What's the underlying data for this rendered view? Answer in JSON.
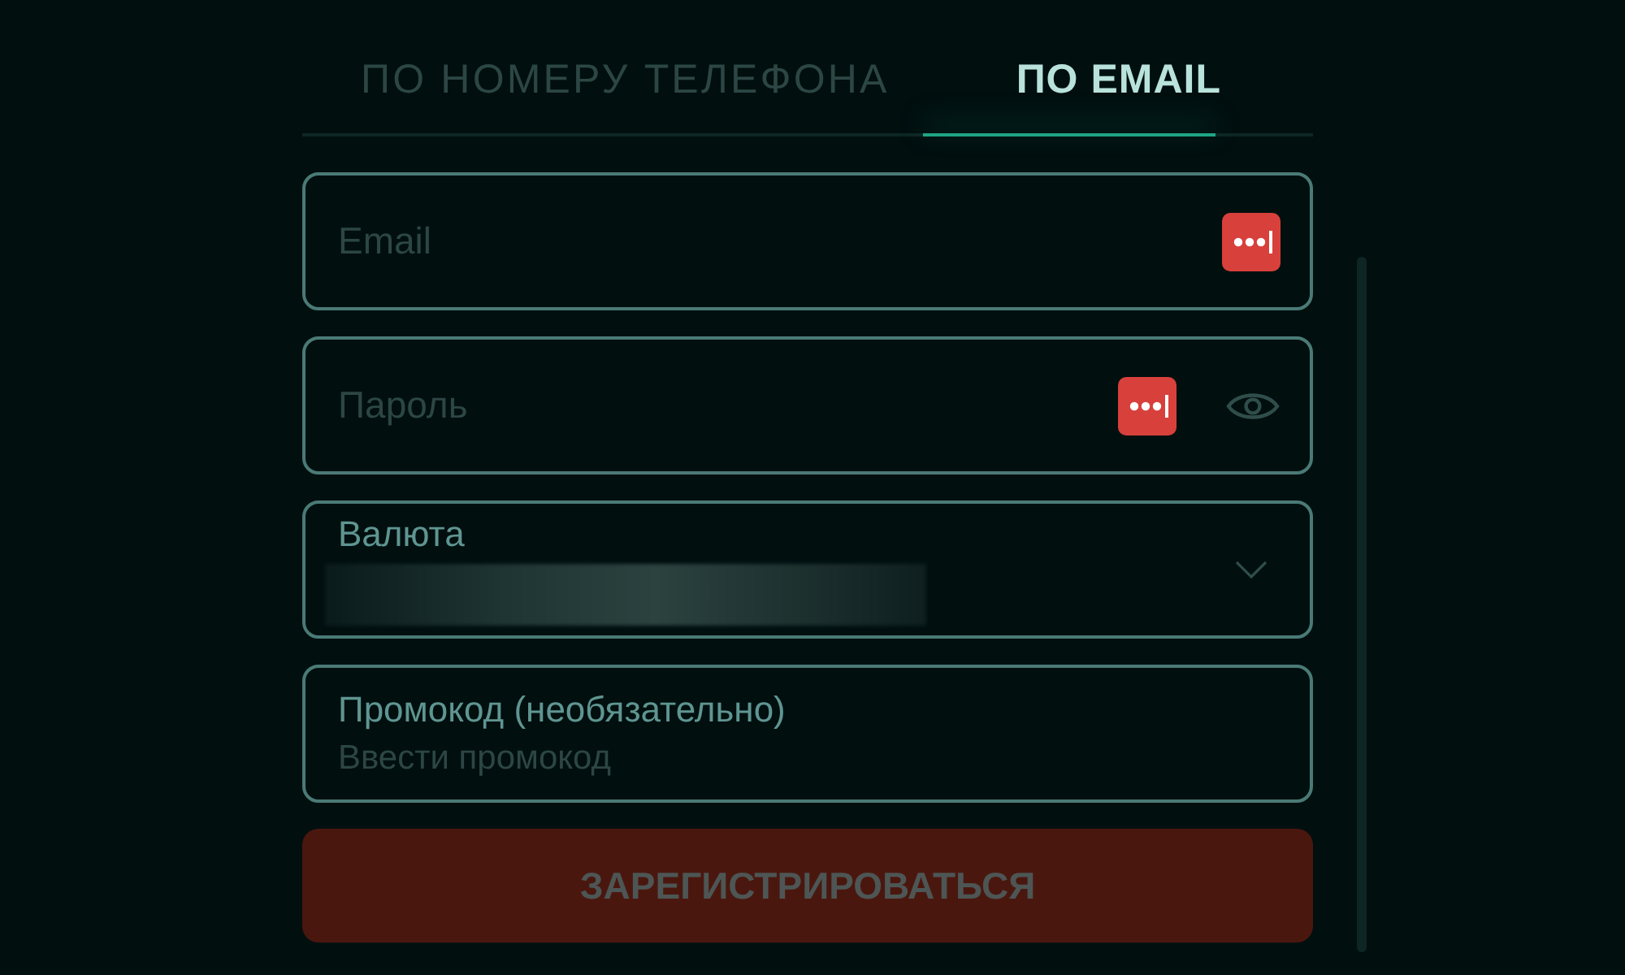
{
  "tabs": [
    {
      "label": "ПО НОМЕРУ ТЕЛЕФОНА",
      "selected": false
    },
    {
      "label": "ПО EMAIL",
      "selected": true
    }
  ],
  "fields": [
    {
      "kind": "text",
      "placeholder": "Email",
      "password_manager": true
    },
    {
      "kind": "password",
      "placeholder": "Пароль",
      "password_manager": true,
      "reveal": true
    },
    {
      "kind": "select",
      "label": "Валюта",
      "value_blurred": true
    },
    {
      "kind": "labeled",
      "label": "Промокод (необязательно)",
      "placeholder": "Ввести промокод"
    }
  ],
  "submit": {
    "label": "ЗАРЕГИСТРИРОВАТЬСЯ",
    "disabled": true
  }
}
